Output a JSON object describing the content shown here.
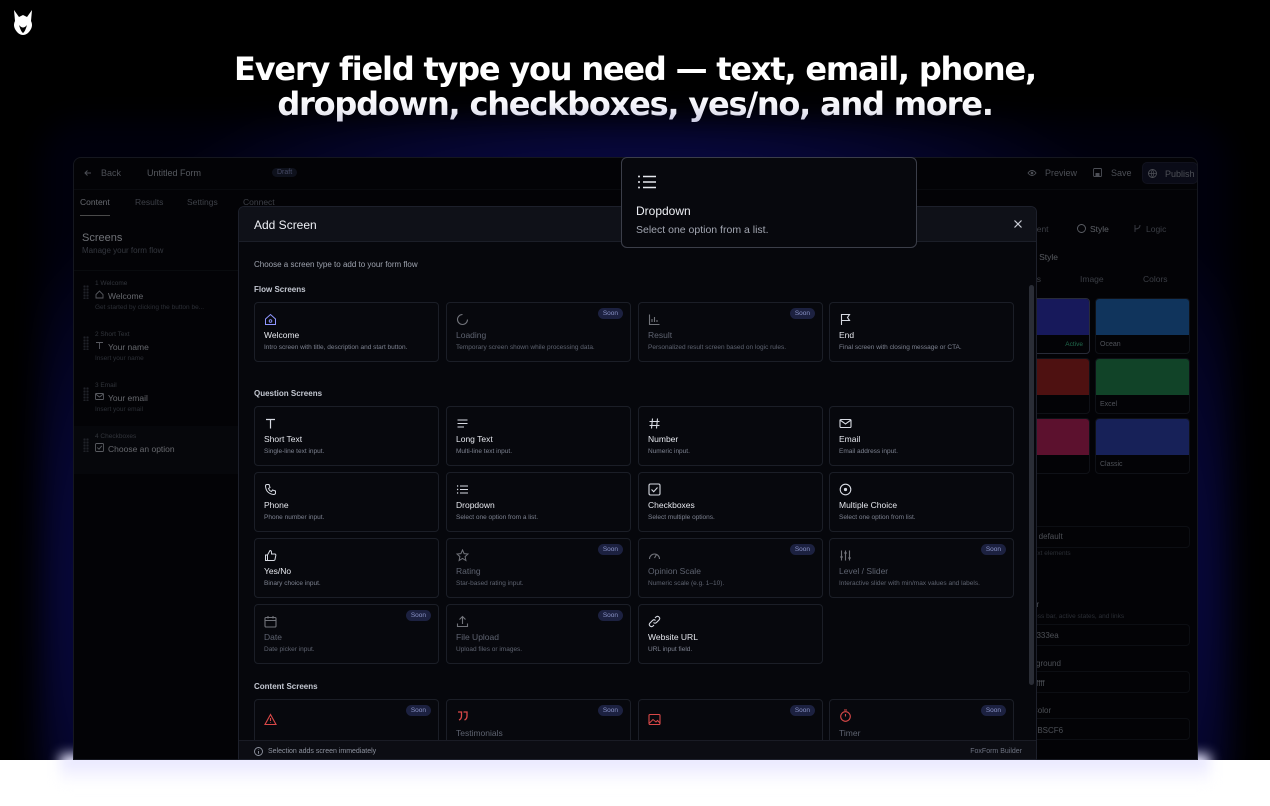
{
  "headline": {
    "line1": "Every field type you need — text, email, phone,",
    "line2": "dropdown, checkboxes, yes/no, and more."
  },
  "topbar": {
    "back_label": "Back",
    "form_title": "Untitled Form",
    "status_badge": "Draft",
    "preview_label": "Preview",
    "save_label": "Save",
    "publish_label": "Publish"
  },
  "nav_tabs": [
    "Content",
    "Results",
    "Settings",
    "Connect"
  ],
  "sidebar": {
    "title": "Screens",
    "subtitle": "Manage your form flow",
    "items": [
      {
        "num": "1  Welcome",
        "name": "Welcome",
        "desc": "Get started by clicking the button be...",
        "icon": "home-icon"
      },
      {
        "num": "2  Short Text",
        "name": "Your name",
        "desc": "Insert your name",
        "icon": "text-icon"
      },
      {
        "num": "3  Email",
        "name": "Your email",
        "desc": "Insert your email",
        "icon": "mail-icon"
      },
      {
        "num": "4  Checkboxes",
        "name": "Choose an option",
        "desc": "",
        "icon": "checkbox-icon"
      }
    ]
  },
  "right_panel": {
    "tabs": [
      "nent",
      "Style",
      "Logic"
    ],
    "heading": "d Style",
    "segments": [
      "es",
      "Image",
      "Colors"
    ],
    "swatches": [
      {
        "label": "",
        "active": "Active",
        "color": "#2a2fa6"
      },
      {
        "label": "Ocean",
        "active": "",
        "color": "#1e5fa8"
      },
      {
        "label": "",
        "active": "",
        "color": "#8f1f1f"
      },
      {
        "label": "Excel",
        "active": "",
        "color": "#1f7a4a"
      },
      {
        "label": "",
        "active": "",
        "color": "#a81f55"
      },
      {
        "label": "Classic",
        "active": "",
        "color": "#2b3ca0"
      }
    ],
    "font_section": "y",
    "font_value": "e default",
    "font_hint": "text elements",
    "color_label": "or",
    "color_hint": "ress bar, active states, and links",
    "color_value": "9333ea",
    "bg_label": "kground",
    "bg_value": "ffffff",
    "text_color_label": "Color",
    "text_color_value": "BBSCF6"
  },
  "modal": {
    "title": "Add Screen",
    "intro": "Choose a screen type to add to your form flow",
    "sections": {
      "flow": "Flow Screens",
      "question": "Question Screens",
      "content": "Content Screens"
    },
    "soon_label": "Soon",
    "flow_cards": [
      {
        "label": "Welcome",
        "desc": "Intro screen with title, description and start button.",
        "icon": "home-icon",
        "soon": false
      },
      {
        "label": "Loading",
        "desc": "Temporary screen shown while processing data.",
        "icon": "loader-icon",
        "soon": true
      },
      {
        "label": "Result",
        "desc": "Personalized result screen based on logic rules.",
        "icon": "bar-chart-icon",
        "soon": true
      },
      {
        "label": "End",
        "desc": "Final screen with closing message or CTA.",
        "icon": "flag-icon",
        "soon": false
      }
    ],
    "question_cards": [
      {
        "label": "Short Text",
        "desc": "Single-line text input.",
        "icon": "text-icon",
        "soon": false
      },
      {
        "label": "Long Text",
        "desc": "Multi-line text input.",
        "icon": "align-left-icon",
        "soon": false
      },
      {
        "label": "Number",
        "desc": "Numeric input.",
        "icon": "hash-icon",
        "soon": false
      },
      {
        "label": "Email",
        "desc": "Email address input.",
        "icon": "mail-icon",
        "soon": false
      },
      {
        "label": "Phone",
        "desc": "Phone number input.",
        "icon": "phone-icon",
        "soon": false
      },
      {
        "label": "Dropdown",
        "desc": "Select one option from a list.",
        "icon": "list-icon",
        "soon": false
      },
      {
        "label": "Checkboxes",
        "desc": "Select multiple options.",
        "icon": "checkbox-icon",
        "soon": false
      },
      {
        "label": "Multiple Choice",
        "desc": "Select one option from list.",
        "icon": "radio-icon",
        "soon": false
      },
      {
        "label": "Yes/No",
        "desc": "Binary choice input.",
        "icon": "thumbs-up-icon",
        "soon": false
      },
      {
        "label": "Rating",
        "desc": "Star-based rating input.",
        "icon": "star-icon",
        "soon": true
      },
      {
        "label": "Opinion Scale",
        "desc": "Numeric scale (e.g. 1–10).",
        "icon": "gauge-icon",
        "soon": true
      },
      {
        "label": "Level / Slider",
        "desc": "Interactive slider with min/max values and labels.",
        "icon": "sliders-icon",
        "soon": true
      },
      {
        "label": "Date",
        "desc": "Date picker input.",
        "icon": "calendar-icon",
        "soon": true
      },
      {
        "label": "File Upload",
        "desc": "Upload files or images.",
        "icon": "upload-icon",
        "soon": true
      },
      {
        "label": "Website URL",
        "desc": "URL input field.",
        "icon": "link-icon",
        "soon": false
      }
    ],
    "content_cards": [
      {
        "label": "",
        "icon": "alert-icon",
        "soon": true
      },
      {
        "label": "Testimonials",
        "icon": "quote-icon",
        "soon": true
      },
      {
        "label": "",
        "icon": "image-icon",
        "soon": true
      },
      {
        "label": "Timer",
        "icon": "timer-icon",
        "soon": true
      }
    ],
    "footer_left": "Selection adds screen immediately",
    "footer_right": "FoxForm Builder"
  },
  "tooltip": {
    "title": "Dropdown",
    "desc": "Select one option from a list.",
    "icon": "list-icon"
  },
  "colors": {
    "background": "#000000",
    "accent_glow": "#2a2adc",
    "soon_badge": "#1c2140",
    "active_green": "#3bbd8a"
  }
}
